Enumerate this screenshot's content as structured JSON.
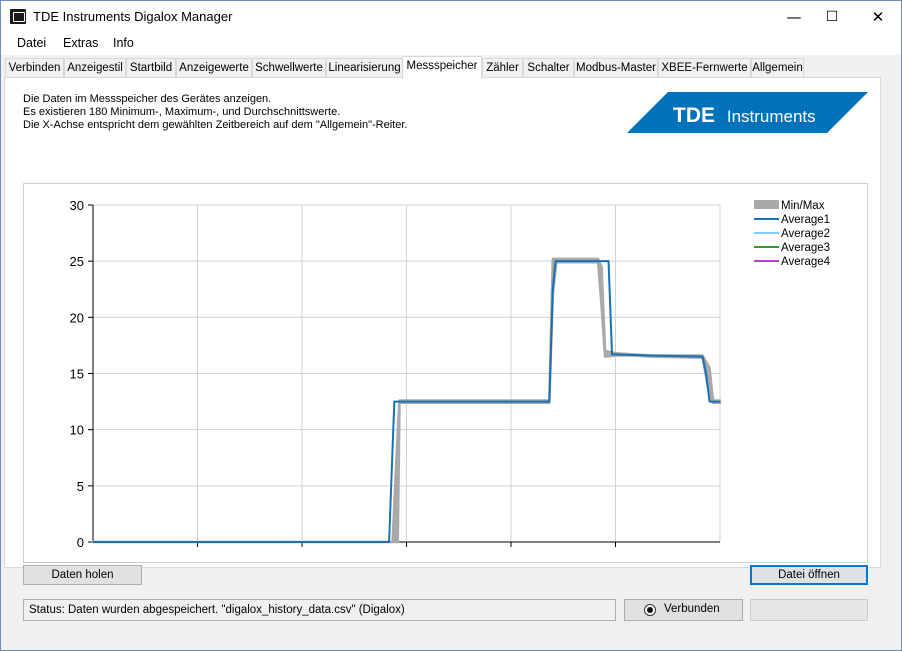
{
  "window": {
    "title": "TDE Instruments Digalox Manager",
    "minimize_glyph": "—",
    "maximize_glyph": "☐",
    "close_glyph": "✕"
  },
  "menu": [
    "Datei",
    "Extras",
    "Info"
  ],
  "tabs": [
    "Verbinden",
    "Anzeigestil",
    "Startbild",
    "Anzeigewerte",
    "Schwellwerte",
    "Linearisierung",
    "Messspeicher",
    "Zähler",
    "Schalter",
    "Modbus-Master",
    "XBEE-Fernwerte",
    "Allgemein"
  ],
  "active_tab": "Messspeicher",
  "description": [
    "Die Daten im Messspeicher des Gerätes anzeigen.",
    "Es existieren 180 Minimum-, Maximum-, und Durchschnittswerte.",
    "Die X-Achse entspricht dem gewählten Zeitbereich auf dem \"Allgemein\"-Reiter."
  ],
  "logo": {
    "bold": "TDE",
    "regular": "Instruments",
    "color": "#0072bc"
  },
  "chart_data": {
    "type": "line",
    "ylim": [
      0,
      30
    ],
    "yticks": [
      "0",
      "5",
      "10",
      "15",
      "20",
      "25",
      "30"
    ],
    "xlim": [
      0,
      180
    ],
    "legend_position": "top-right",
    "grid": true,
    "series": [
      {
        "name": "Min/Max",
        "color": "#a9a9a9",
        "style": "band",
        "x": [
          0,
          86,
          87.5,
          88,
          131,
          132,
          133,
          134,
          145,
          146,
          147,
          150,
          155,
          160,
          175,
          177,
          178,
          180
        ],
        "min": [
          0,
          0,
          0,
          12.4,
          12.4,
          22,
          24.9,
          24.9,
          24.9,
          21,
          16.5,
          16.6,
          16.6,
          16.5,
          16.4,
          13,
          12.4,
          12.4
        ],
        "max": [
          0,
          0,
          10,
          12.6,
          12.6,
          25.2,
          25.2,
          25.2,
          25.2,
          24.5,
          17,
          16.8,
          16.7,
          16.6,
          16.6,
          15.5,
          12.6,
          12.6
        ]
      },
      {
        "name": "Average1",
        "color": "#1f6fb0",
        "x": [
          0,
          85,
          86.5,
          131,
          132,
          132.8,
          148,
          149,
          150,
          155,
          160,
          175,
          176,
          177,
          180
        ],
        "values": [
          0,
          0,
          12.5,
          12.5,
          22.5,
          25.0,
          25.0,
          16.7,
          16.7,
          16.65,
          16.6,
          16.5,
          15.0,
          12.5,
          12.5
        ]
      },
      {
        "name": "Average2",
        "color": "#87cefa",
        "values": []
      },
      {
        "name": "Average3",
        "color": "#2ca02c",
        "values": []
      },
      {
        "name": "Average4",
        "color": "#b244c4",
        "values": []
      }
    ]
  },
  "buttons": {
    "fetch": "Daten holen",
    "open": "Datei öffnen"
  },
  "status": {
    "text": "Status: Daten wurden abgespeichert. \"digalox_history_data.csv\" (Digalox)",
    "connection": "Verbunden"
  }
}
